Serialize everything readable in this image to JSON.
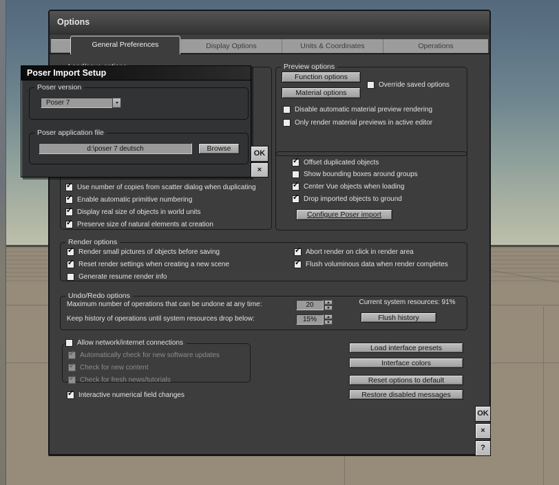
{
  "window": {
    "title": "Options",
    "buttons": {
      "ok": "OK",
      "close": "×",
      "help": "?"
    }
  },
  "tabs": {
    "items": [
      {
        "label": "General Preferences",
        "selected": true
      },
      {
        "label": "Display Options",
        "selected": false
      },
      {
        "label": "Units & Coordinates",
        "selected": false
      },
      {
        "label": "Operations",
        "selected": false
      }
    ]
  },
  "poser_dialog": {
    "title": "Poser Import Setup",
    "version_group": "Poser version",
    "version_value": "Poser 7",
    "file_group": "Poser application file",
    "file_value": "d:\\poser 7 deutsch",
    "browse_button": "Browse",
    "ok_button": "OK",
    "close_button": "×"
  },
  "load_save": {
    "title": "Load/save options",
    "items": [
      {
        "label": "Use number of copies from scatter dialog when duplicating",
        "checked": true
      },
      {
        "label": "Enable automatic primitive numbering",
        "checked": true
      },
      {
        "label": "Display real size of objects in world units",
        "checked": true
      },
      {
        "label": "Preserve size of natural elements at creation",
        "checked": true
      }
    ]
  },
  "preview": {
    "title": "Preview options",
    "function_button": "Function options",
    "material_button": "Material options",
    "override": {
      "label": "Override saved options",
      "checked": false
    },
    "items": [
      {
        "label": "Disable automatic material preview rendering",
        "checked": false
      },
      {
        "label": "Only render material previews in active editor",
        "checked": false
      }
    ]
  },
  "import_options": {
    "items": [
      {
        "label": "Offset duplicated objects",
        "checked": true
      },
      {
        "label": "Show bounding boxes around groups",
        "checked": false
      },
      {
        "label": "Center Vue objects when loading",
        "checked": true
      },
      {
        "label": "Drop imported objects to ground",
        "checked": true
      }
    ],
    "configure_button": "Configure Poser import"
  },
  "render": {
    "title": "Render options",
    "left": [
      {
        "label": "Render small pictures of objects before saving",
        "checked": true
      },
      {
        "label": "Reset render settings when creating a new scene",
        "checked": true
      },
      {
        "label": "Generate resume render info",
        "checked": false
      }
    ],
    "right": [
      {
        "label": "Abort render on click in render area",
        "checked": true
      },
      {
        "label": "Flush voluminous data when render completes",
        "checked": true
      }
    ]
  },
  "undo": {
    "title": "Undo/Redo options",
    "max_label": "Maximum number of operations that can be undone at any time:",
    "max_value": "20",
    "keep_label": "Keep history of operations until system resources drop below:",
    "keep_value": "15%",
    "resources_text": "Current system resources: 91%",
    "flush_button": "Flush history"
  },
  "network": {
    "label": "Allow network/internet connections",
    "checked": false,
    "items": [
      {
        "label": "Automatically check for new software updates",
        "checked": true
      },
      {
        "label": "Check for new content",
        "checked": true
      },
      {
        "label": "Check for fresh news/tutorials",
        "checked": true
      }
    ]
  },
  "misc": {
    "interactive": {
      "label": "Interactive numerical field changes",
      "checked": true
    }
  },
  "side_buttons": {
    "items": [
      {
        "label": "Load interface presets"
      },
      {
        "label": "Interface colors"
      },
      {
        "label": "Reset options to default"
      },
      {
        "label": "Restore disabled messages"
      }
    ]
  },
  "colors": {
    "dialog_bg": "#3d3d3d",
    "field_bg": "#9a9a9a",
    "sky_top": "#54697c",
    "ground": "#978c7a"
  }
}
